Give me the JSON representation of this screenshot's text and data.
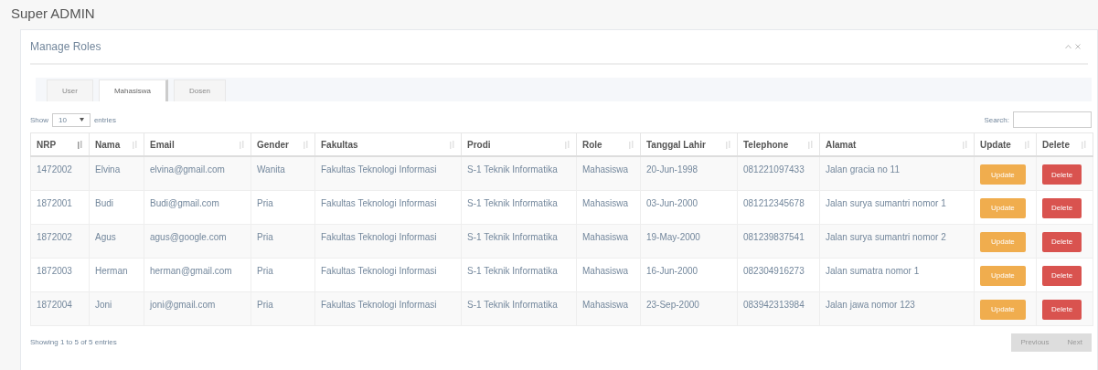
{
  "page_title": "Super ADMIN",
  "panel": {
    "title": "Manage Roles"
  },
  "tabs": [
    {
      "label": "User",
      "selected": false
    },
    {
      "label": "Mahasiswa",
      "selected": true
    },
    {
      "label": "Dosen",
      "selected": false
    }
  ],
  "length_control": {
    "prefix": "Show",
    "value": "10",
    "suffix": "entries"
  },
  "search": {
    "label": "Search:"
  },
  "table": {
    "columns": [
      {
        "label": "NRP",
        "sorted": true
      },
      {
        "label": "Nama",
        "sorted": false
      },
      {
        "label": "Email",
        "sorted": false
      },
      {
        "label": "Gender",
        "sorted": false
      },
      {
        "label": "Fakultas",
        "sorted": false
      },
      {
        "label": "Prodi",
        "sorted": false
      },
      {
        "label": "Role",
        "sorted": false
      },
      {
        "label": "Tanggal Lahir",
        "sorted": false
      },
      {
        "label": "Telephone",
        "sorted": false
      },
      {
        "label": "Alamat",
        "sorted": false
      },
      {
        "label": "Update",
        "sorted": false
      },
      {
        "label": "Delete",
        "sorted": false
      }
    ],
    "rows": [
      {
        "cells": [
          "1472002",
          "Elvina",
          "elvina@gmail.com",
          "Wanita",
          "Fakultas Teknologi Informasi",
          "S-1 Teknik Informatika",
          "Mahasiswa",
          "20-Jun-1998",
          "081221097433",
          "Jalan gracia no 11"
        ],
        "update": "Update",
        "delete": "Delete"
      },
      {
        "cells": [
          "1872001",
          "Budi",
          "Budi@gmail.com",
          "Pria",
          "Fakultas Teknologi Informasi",
          "S-1 Teknik Informatika",
          "Mahasiswa",
          "03-Jun-2000",
          "081212345678",
          "Jalan surya sumantri nomor 1"
        ],
        "update": "Update",
        "delete": "Delete"
      },
      {
        "cells": [
          "1872002",
          "Agus",
          "agus@google.com",
          "Pria",
          "Fakultas Teknologi Informasi",
          "S-1 Teknik Informatika",
          "Mahasiswa",
          "19-May-2000",
          "081239837541",
          "Jalan surya sumantri nomor 2"
        ],
        "update": "Update",
        "delete": "Delete"
      },
      {
        "cells": [
          "1872003",
          "Herman",
          "herman@gmail.com",
          "Pria",
          "Fakultas Teknologi Informasi",
          "S-1 Teknik Informatika",
          "Mahasiswa",
          "16-Jun-2000",
          "082304916273",
          "Jalan sumatra nomor 1"
        ],
        "update": "Update",
        "delete": "Delete"
      },
      {
        "cells": [
          "1872004",
          "Joni",
          "joni@gmail.com",
          "Pria",
          "Fakultas Teknologi Informasi",
          "S-1 Teknik Informatika",
          "Mahasiswa",
          "23-Sep-2000",
          "083942313984",
          "Jalan jawa nomor 123"
        ],
        "update": "Update",
        "delete": "Delete"
      }
    ]
  },
  "info": "Showing 1 to 5 of 5 entries",
  "pagination": {
    "previous": "Previous",
    "next": "Next"
  }
}
